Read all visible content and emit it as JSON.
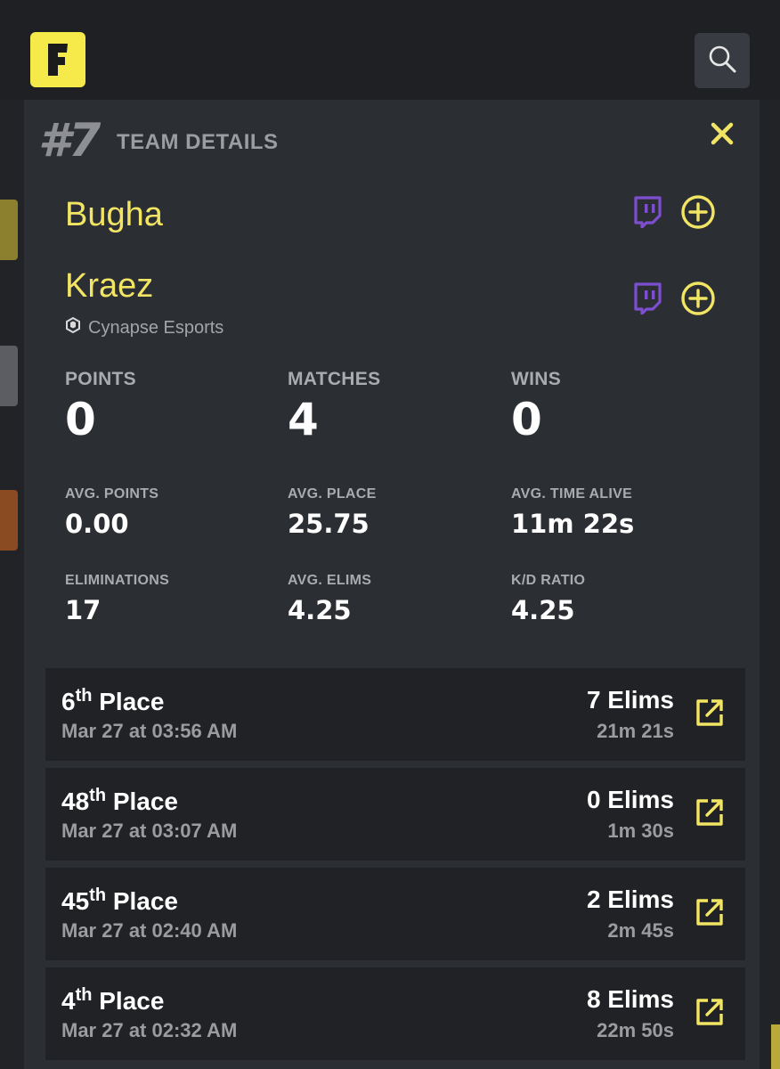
{
  "header": {
    "logo_letter": "F"
  },
  "panel": {
    "rank": "#7",
    "title": "TEAM DETAILS",
    "players": [
      {
        "name": "Bugha"
      },
      {
        "name": "Kraez",
        "org": "Cynapse Esports"
      }
    ]
  },
  "stats": {
    "points_label": "POINTS",
    "points_value": "0",
    "matches_label": "MATCHES",
    "matches_value": "4",
    "wins_label": "WINS",
    "wins_value": "0",
    "avg_points_label": "AVG. POINTS",
    "avg_points_value": "0.00",
    "avg_place_label": "AVG. PLACE",
    "avg_place_value": "25.75",
    "avg_time_label": "AVG. TIME ALIVE",
    "avg_time_value": "11m 22s",
    "elims_label": "ELIMINATIONS",
    "elims_value": "17",
    "avg_elims_label": "AVG. ELIMS",
    "avg_elims_value": "4.25",
    "kd_label": "K/D RATIO",
    "kd_value": "4.25"
  },
  "matches": [
    {
      "place_num": "6",
      "place_suffix": "th",
      "place_word": "Place",
      "date": "Mar 27 at 03:56 AM",
      "elims": "7 Elims",
      "duration": "21m 21s"
    },
    {
      "place_num": "48",
      "place_suffix": "th",
      "place_word": "Place",
      "date": "Mar 27 at 03:07 AM",
      "elims": "0 Elims",
      "duration": "1m 30s"
    },
    {
      "place_num": "45",
      "place_suffix": "th",
      "place_word": "Place",
      "date": "Mar 27 at 02:40 AM",
      "elims": "2 Elims",
      "duration": "2m 45s"
    },
    {
      "place_num": "4",
      "place_suffix": "th",
      "place_word": "Place",
      "date": "Mar 27 at 02:32 AM",
      "elims": "8 Elims",
      "duration": "22m 50s"
    }
  ],
  "icons": {
    "logo": "fortnite-logo-icon",
    "search": "search-icon",
    "close": "close-icon",
    "twitch": "twitch-icon",
    "add": "add-circle-icon",
    "org": "cynapse-logo-icon",
    "external": "external-link-icon"
  },
  "colors": {
    "accent": "#f2e563",
    "twitch": "#7d4fd0",
    "panel_bg": "#2b2e33",
    "row_bg": "#202226"
  }
}
